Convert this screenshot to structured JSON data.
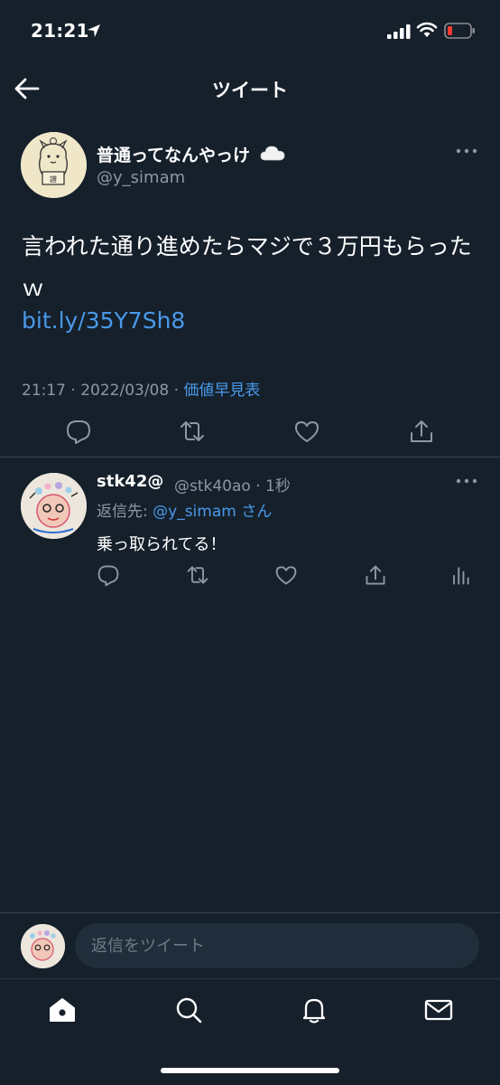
{
  "status": {
    "time": "21:21",
    "icons": [
      "location-arrow-icon",
      "cellular-signal-icon",
      "wifi-icon",
      "battery-low-icon"
    ]
  },
  "header": {
    "title": "ツイート",
    "back_icon": "arrow-left-icon"
  },
  "tweet": {
    "author_name": "普通ってなんやっけ",
    "author_emoji": "cloud-icon",
    "author_handle": "@y_simam",
    "text": "言われた通り進めたらマジで３万円もらったｗ",
    "link": "bit.ly/35Y7Sh8",
    "timestamp": "21:17 · 2022/03/08 · ",
    "source": "価値早見表",
    "actions": [
      "reply-icon",
      "retweet-icon",
      "like-icon",
      "share-icon"
    ]
  },
  "reply": {
    "name": "stk42@",
    "handle_time": "@stk40ao · 1秒",
    "reply_prefix": "返信先: ",
    "reply_mention": "@y_simam",
    "reply_suffix": " さん",
    "text": "乗っ取られてる！",
    "actions": [
      "reply-icon",
      "retweet-icon",
      "like-icon",
      "share-icon",
      "analytics-icon"
    ]
  },
  "composer": {
    "placeholder": "返信をツイート"
  },
  "tabbar": {
    "items": [
      "home-icon",
      "search-icon",
      "notifications-icon",
      "messages-icon"
    ]
  },
  "colors": {
    "background": "#15202b",
    "accent": "#4a99e9",
    "secondary_text": "#8b98a5",
    "divider": "#38444d"
  }
}
